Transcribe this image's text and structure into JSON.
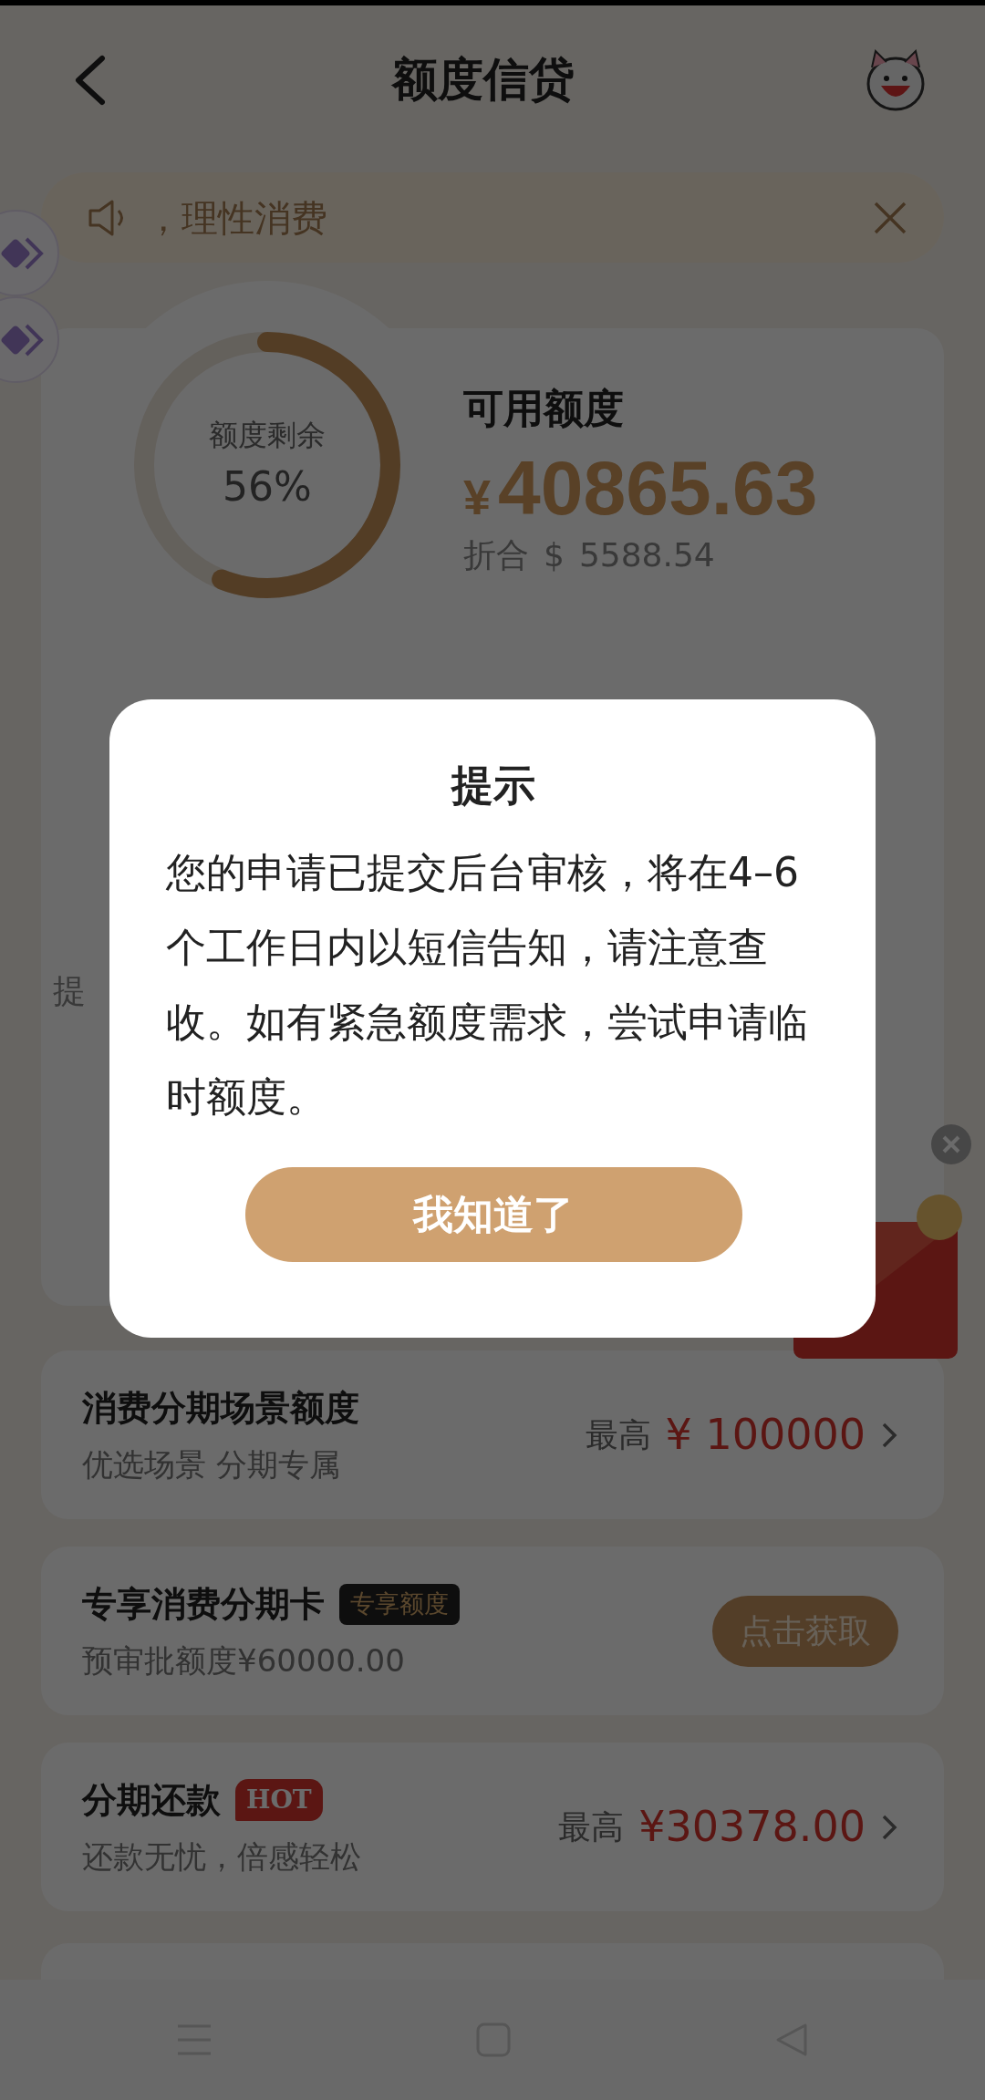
{
  "header": {
    "title": "额度信贷"
  },
  "notice": {
    "text": "，理性消费"
  },
  "credit": {
    "ring_label": "额度剩余",
    "ring_percent": "56%",
    "level": 0.56,
    "available_label": "可用额度",
    "currency": "¥",
    "amount": "40865.63",
    "converted_label": "折合",
    "converted_currency": "$",
    "converted_amount": "5588.54",
    "side_text": "提"
  },
  "products": [
    {
      "kind": "link",
      "title": "消费分期场景额度",
      "subtitle": "优选场景 分期专属",
      "prefix": "最高",
      "value": "¥ 100000"
    },
    {
      "kind": "action",
      "title": "专享消费分期卡",
      "tag": {
        "kind": "dark",
        "text": "专享额度"
      },
      "subtitle": "预审批额度¥60000.00",
      "action": "点击获取"
    },
    {
      "kind": "link",
      "title": "分期还款",
      "tag": {
        "kind": "hot",
        "text": "HOT"
      },
      "subtitle": "还款无忧，倍感轻松",
      "prefix": "最高",
      "value": "¥30378.00"
    }
  ],
  "dialog": {
    "title": "提示",
    "message": "您的申请已提交后台审核，将在4–6个工作日内以短信告知，请注意查收。如有紧急额度需求，尝试申请临时额度。",
    "button": "我知道了"
  }
}
